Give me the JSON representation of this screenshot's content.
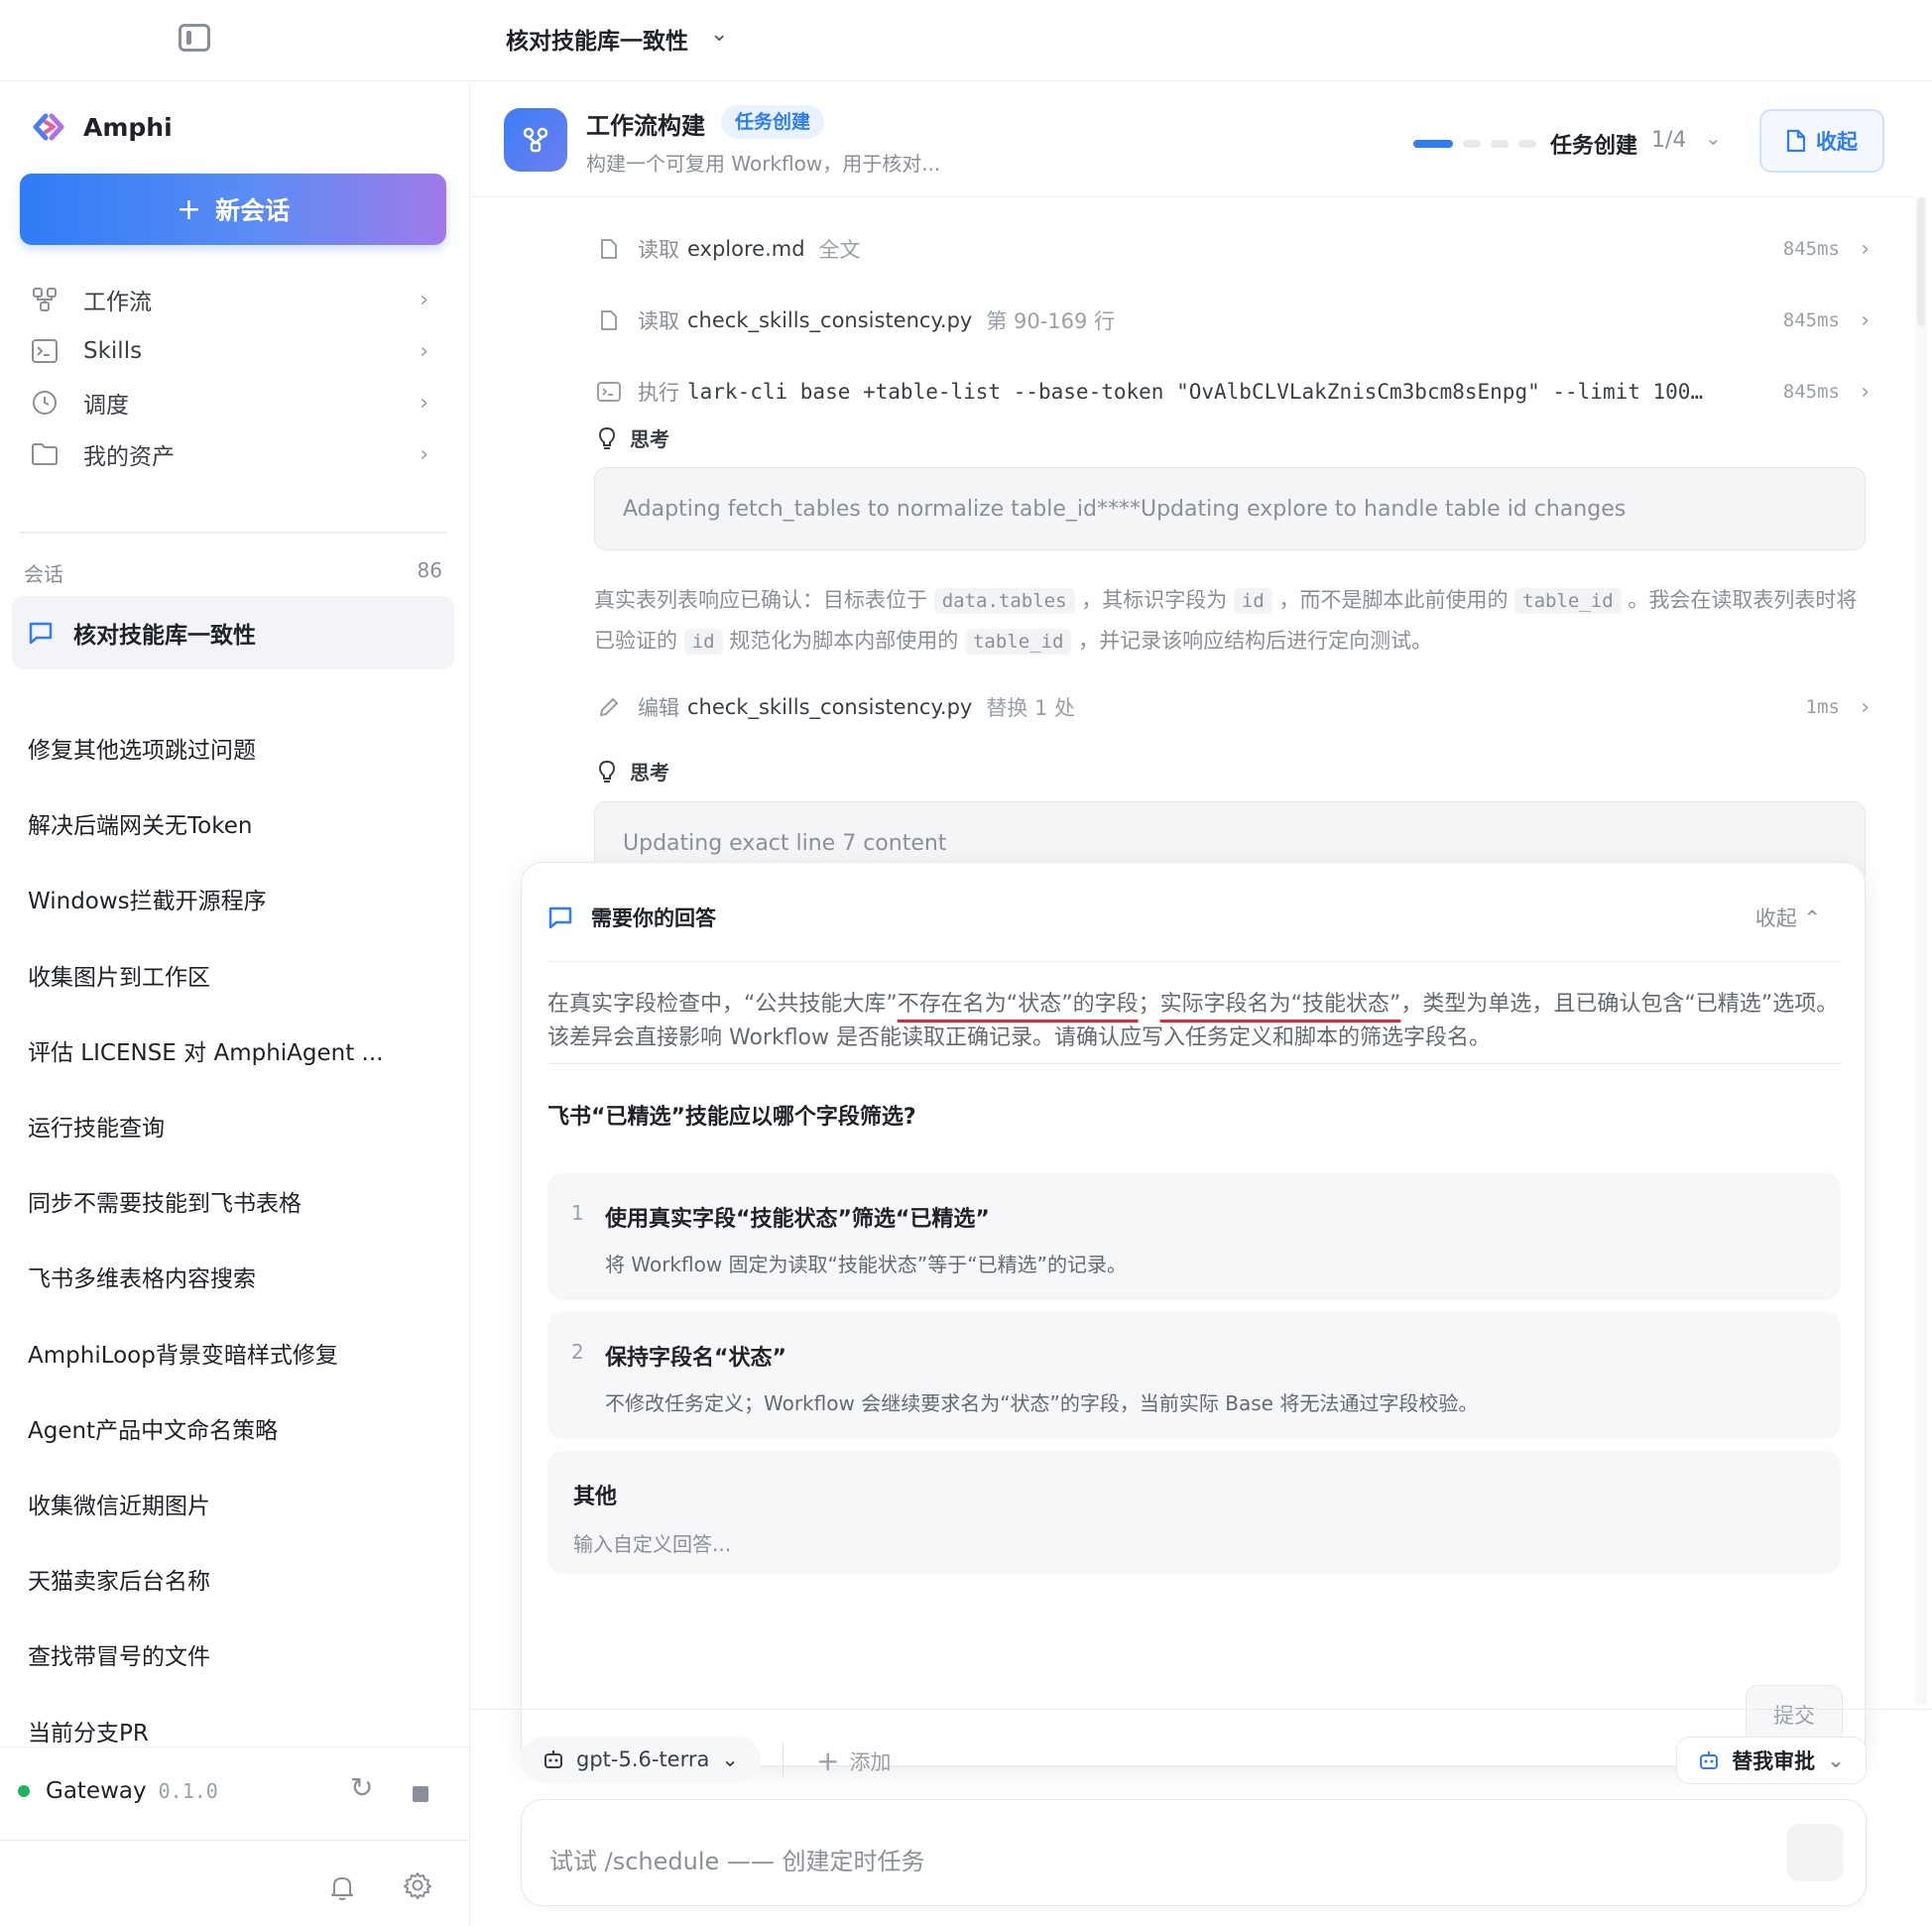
{
  "topbar": {
    "session_title": "核对技能库一致性"
  },
  "sidebar": {
    "brand": "Amphi",
    "new_chat": "新会话",
    "nav": [
      {
        "label": "工作流",
        "icon": "workflow-icon"
      },
      {
        "label": "Skills",
        "icon": "terminal-icon"
      },
      {
        "label": "调度",
        "icon": "clock-icon"
      },
      {
        "label": "我的资产",
        "icon": "folder-icon"
      }
    ],
    "conv_header": "会话",
    "conv_count": "86",
    "active_conversation": "核对技能库一致性",
    "conversations": [
      "修复其他选项跳过问题",
      "解决后端网关无Token",
      "Windows拦截开源程序",
      "收集图片到工作区",
      "评估 LICENSE 对 AmphiAgent ...",
      "运行技能查询",
      "同步不需要技能到飞书表格",
      "飞书多维表格内容搜索",
      "AmphiLoop背景变暗样式修复",
      "Agent产品中文命名策略",
      "收集微信近期图片",
      "天猫卖家后台名称",
      "查找带冒号的文件",
      "当前分支PR"
    ],
    "gateway": {
      "label": "Gateway",
      "version": "0.1.0",
      "status_color": "#22b45a"
    }
  },
  "task": {
    "title": "工作流构建",
    "badge": "任务创建",
    "description": "构建一个可复用 Workflow，用于核对...",
    "progress_label": "任务创建",
    "progress_count": "1/4",
    "progress_current": 1,
    "progress_total": 4,
    "collapse_label": "收起"
  },
  "log": [
    {
      "verb": "读取",
      "target": "explore.md",
      "suffix": "全文",
      "duration": "845ms"
    },
    {
      "verb": "读取",
      "target": "check_skills_consistency.py",
      "suffix": "第 90-169 行",
      "duration": "845ms"
    },
    {
      "verb": "执行",
      "target": "lark-cli base +table-list --base-token \"OvAlbCLVLakZnisCm3bcm8sEnpg\" --limit 100…",
      "duration": "845ms"
    },
    {
      "verb": "编辑",
      "target": "check_skills_consistency.py",
      "suffix": "替换 1 处",
      "duration": "1ms"
    }
  ],
  "think": {
    "label": "思考",
    "first": "Adapting fetch_tables to normalize table_id****Updating explore to handle table id changes",
    "second": "Updating exact line 7 content"
  },
  "reasoning": {
    "p1": "真实表列表响应已确认：目标表位于",
    "c1": "data.tables",
    "p2": "，其标识字段为",
    "c2": "id",
    "p3": "，而不是脚本此前使用的",
    "c3": "table_id",
    "p4": "。我会在读取表列表时将已验证的",
    "c4": "id",
    "p5": "规范化为脚本内部使用的",
    "c5": "table_id",
    "p6": "，并记录该响应结构后进行定向测试。"
  },
  "question_card": {
    "header": "需要你的回答",
    "collapse": "收起",
    "desc_a": "在真实字段检查中，“公共技能大库”",
    "desc_b": "不存在名为“状态”的字段",
    "desc_c": "；",
    "desc_d": "实际字段名为“技能状态”",
    "desc_e": "，类型为单选，且已确认包含“已精选”选项。该差异会直接影响 Workflow 是否能读取正确记录。请确认应写入任务定义和脚本的筛选字段名。",
    "question": "飞书“已精选”技能应以哪个字段筛选?",
    "options": [
      {
        "num": "1",
        "title": "使用真实字段“技能状态”筛选“已精选”",
        "desc": "将 Workflow 固定为读取“技能状态”等于“已精选”的记录。"
      },
      {
        "num": "2",
        "title": "保持字段名“状态”",
        "desc": "不修改任务定义；Workflow 会继续要求名为“状态”的字段，当前实际 Base 将无法通过字段校验。"
      }
    ],
    "other_title": "其他",
    "other_placeholder": "输入自定义回答...",
    "submit": "提交"
  },
  "composer": {
    "model": "gpt-5.6-terra",
    "add": "添加",
    "approve": "替我审批",
    "placeholder": "试试 /schedule —— 创建定时任务"
  },
  "colors": {
    "accent": "#2f7cf6",
    "underline": "#e0283a"
  }
}
